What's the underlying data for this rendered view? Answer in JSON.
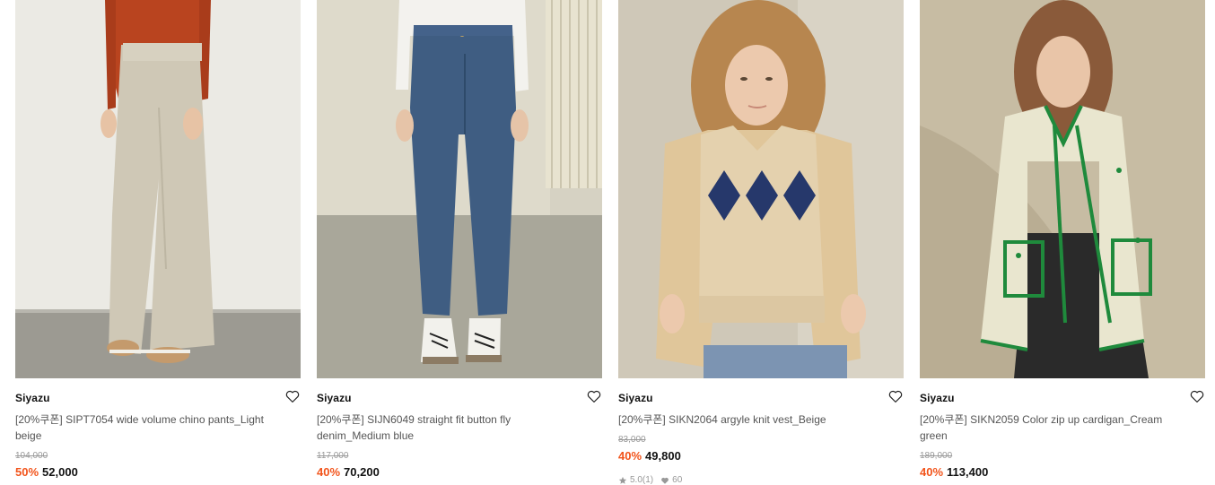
{
  "products": [
    {
      "brand": "Siyazu",
      "title": "[20%쿠폰] SIPT7054 wide volume chino pants_Light beige",
      "original_price": "104,000",
      "discount": "50%",
      "price": "52,000",
      "image_icon": "product-photo"
    },
    {
      "brand": "Siyazu",
      "title": "[20%쿠폰] SIJN6049 straight fit button fly denim_Medium blue",
      "original_price": "117,000",
      "discount": "40%",
      "price": "70,200",
      "image_icon": "product-photo"
    },
    {
      "brand": "Siyazu",
      "title": "[20%쿠폰] SIKN2064 argyle knit vest_Beige",
      "original_price": "83,000",
      "discount": "40%",
      "price": "49,800",
      "rating": "5.0",
      "review_count": "(1)",
      "likes": "60",
      "image_icon": "product-photo"
    },
    {
      "brand": "Siyazu",
      "title": "[20%쿠폰] SIKN2059 Color zip up cardigan_Cream green",
      "original_price": "189,000",
      "discount": "40%",
      "price": "113,400",
      "image_icon": "product-photo"
    }
  ],
  "colors": {
    "discount": "#f2541b",
    "muted": "#999999"
  },
  "icons": {
    "wishlist": "heart-outline-icon",
    "rating": "star-icon",
    "likes": "heart-filled-icon"
  }
}
